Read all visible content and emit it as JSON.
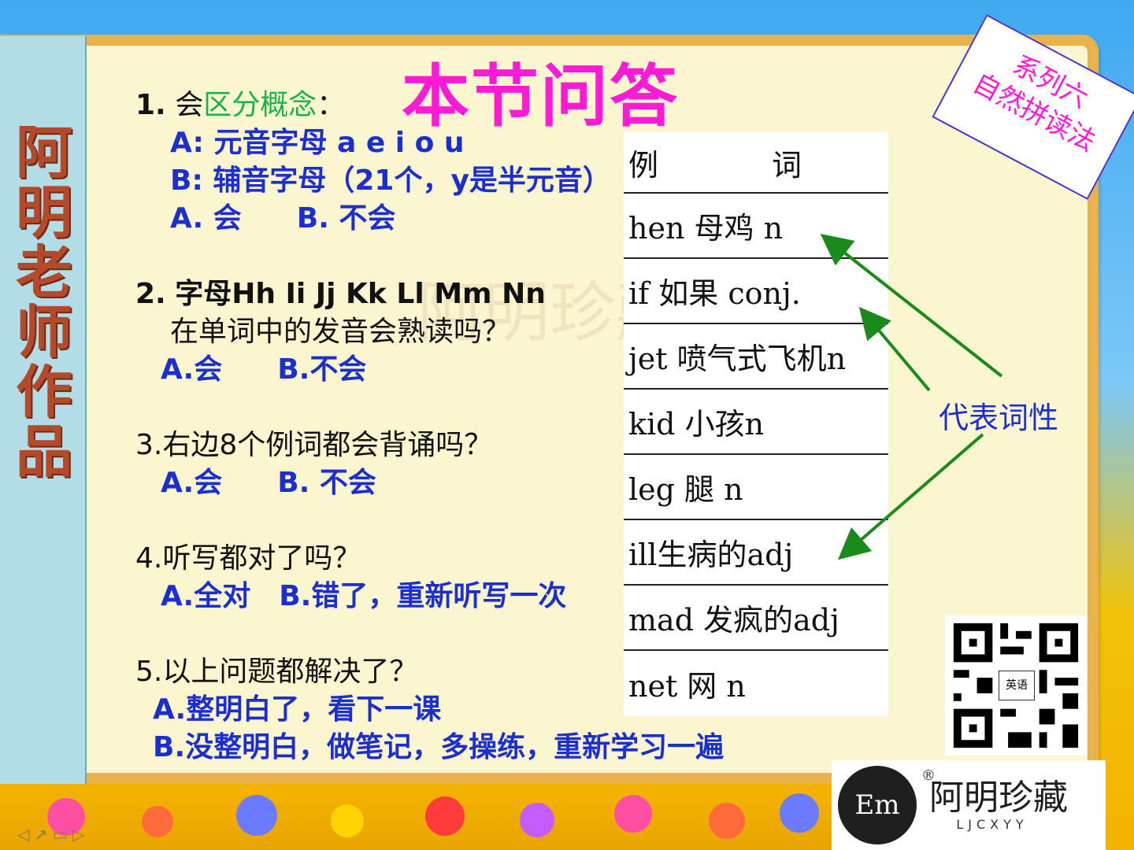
{
  "side": {
    "text": "阿明老师 作品"
  },
  "title": "本节问答",
  "watermark": "阿明珍藏",
  "q1": {
    "num": "1.",
    "prefix": "会",
    "highlight": "区分概念",
    "colon": "：",
    "a": "A: 元音字母 a e i o u",
    "b": "B: 辅音字母（21个，y是半元音）",
    "opt_a": "A. 会",
    "opt_b": "B. 不会"
  },
  "q2": {
    "num": "2.",
    "text": "字母Hh  Ii  Jj   Kk   Ll   Mm   Nn",
    "text2": "在单词中的发音会熟读吗？",
    "opt_a": "A.会",
    "opt_b": "B.不会"
  },
  "q3": {
    "text": "3.右边8个例词都会背诵吗？",
    "opt_a": "A.会",
    "opt_b": "B. 不会"
  },
  "q4": {
    "text": "4.听写都对了吗？",
    "opt_a": "A.全对",
    "opt_b": "B.错了，重新听写一次"
  },
  "q5": {
    "text": "5.以上问题都解决了？",
    "opt_a": "A.整明白了，看下一课",
    "opt_b": "B.没整明白，做笔记，多操练，重新学习一遍"
  },
  "table": {
    "head_left": "例",
    "head_right": "词",
    "rows": [
      "hen  母鸡 n",
      "if  如果 conj.",
      "jet 喷气式飞机n",
      "kid 小孩n",
      "leg 腿 n",
      "ill生病的adj",
      "mad 发疯的adj",
      "net 网 n"
    ]
  },
  "series": {
    "line1": "系列六",
    "line2": "自然拼读法"
  },
  "arrow_label": "代表词性",
  "qr": {
    "center": "英语"
  },
  "brand": {
    "logo": "Em",
    "name": "阿明珍藏",
    "sub": "LJCXYY",
    "reg": "®"
  },
  "colors": {
    "title": "#ff1ad6",
    "blue": "#1b2fd0",
    "green": "#16b34a",
    "arrow": "#1a8a1a"
  }
}
